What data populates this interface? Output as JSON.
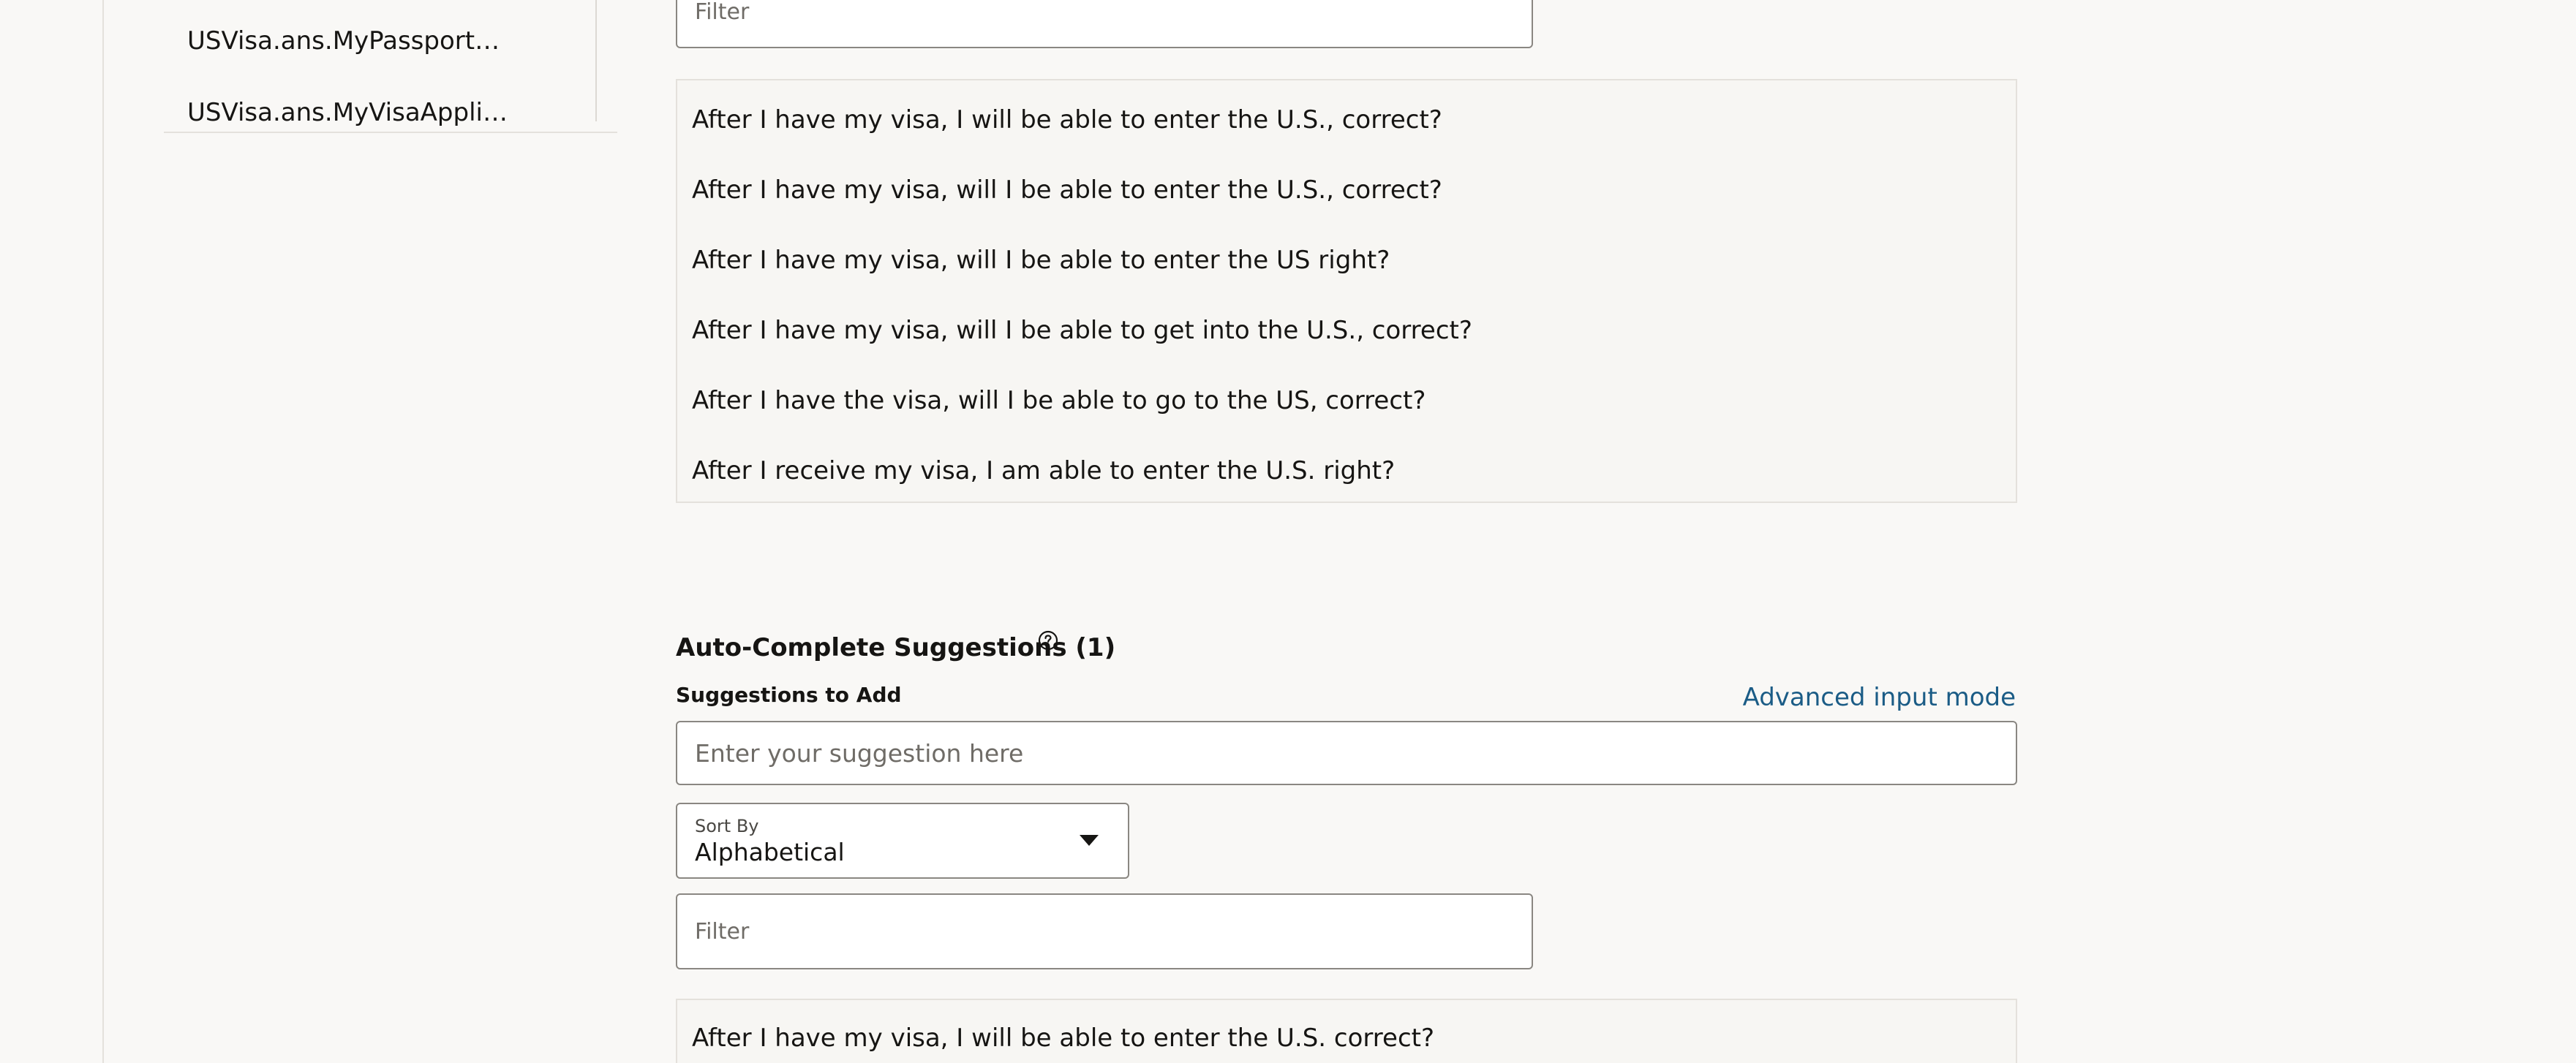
{
  "sidebar": {
    "items": [
      {
        "label": "USVisa.ans.MyPassportWithinValidity"
      },
      {
        "label": "USVisa.ans.MyVisaApplicationStatus"
      }
    ]
  },
  "top_section": {
    "filter_placeholder": "Filter",
    "rows": [
      "After I have my visa, I will be able to enter the U.S., correct?",
      "After I have my visa, will I be able to enter the U.S., correct?",
      "After I have my visa, will I be able to enter the US right?",
      "After I have my visa, will I be able to get into the U.S., correct?",
      "After I have the visa, will I be able to go to the US, correct?",
      "After I receive my visa, I am able to enter the U.S. right?"
    ]
  },
  "autocomplete": {
    "title": "Auto-Complete Suggestions (1)",
    "help_icon": "question-circle-icon",
    "suggestions_label": "Suggestions to Add",
    "advanced_link": "Advanced input mode",
    "input_placeholder": "Enter your suggestion here",
    "sort": {
      "label": "Sort By",
      "value": "Alphabetical"
    },
    "filter_placeholder": "Filter",
    "rows": [
      "After I have my visa, I will be able to enter the U.S. correct?"
    ]
  },
  "colors": {
    "background": "#f9f8f6",
    "link": "#1b5c86",
    "border": "#8a8782"
  }
}
